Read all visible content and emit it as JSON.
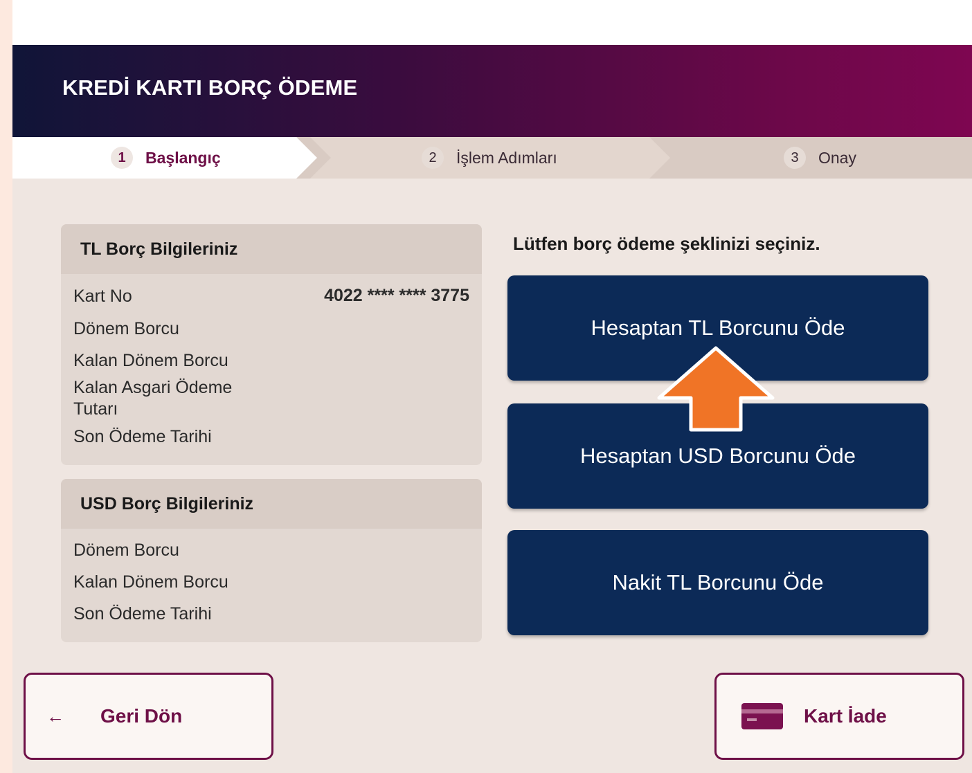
{
  "header": {
    "title": "KREDİ KARTI BORÇ ÖDEME"
  },
  "steps": [
    {
      "num": "1",
      "label": "Başlangıç",
      "active": true
    },
    {
      "num": "2",
      "label": "İşlem Adımları",
      "active": false
    },
    {
      "num": "3",
      "label": "Onay",
      "active": false
    }
  ],
  "tl_panel": {
    "title": "TL Borç Bilgileriniz",
    "rows": [
      {
        "label": "Kart No",
        "value": "4022 **** **** 3775"
      },
      {
        "label": "Dönem Borcu"
      },
      {
        "label": "Kalan Dönem Borcu"
      },
      {
        "label": "Kalan Asgari Ödeme Tutarı"
      },
      {
        "label": "Son Ödeme Tarihi"
      }
    ]
  },
  "usd_panel": {
    "title": "USD Borç Bilgileriniz",
    "rows": [
      {
        "label": "Dönem Borcu"
      },
      {
        "label": "Kalan Dönem Borcu"
      },
      {
        "label": "Son Ödeme Tarihi"
      }
    ]
  },
  "main": {
    "prompt": "Lütfen borç ödeme şeklinizi seçiniz.",
    "buttons": [
      {
        "label": "Hesaptan TL Borcunu Öde"
      },
      {
        "label": "Hesaptan USD Borcunu Öde"
      },
      {
        "label": "Nakit TL Borcunu Öde"
      }
    ],
    "highlight_arrow_color": "#f07426"
  },
  "footer": {
    "back_label": "Geri Dön",
    "back_icon": "arrow-left-icon",
    "card_return_label": "Kart İade",
    "card_icon": "card-icon"
  },
  "colors": {
    "brand": "#6e1047",
    "button_navy": "#0c2a57",
    "background": "#efe6e1"
  }
}
